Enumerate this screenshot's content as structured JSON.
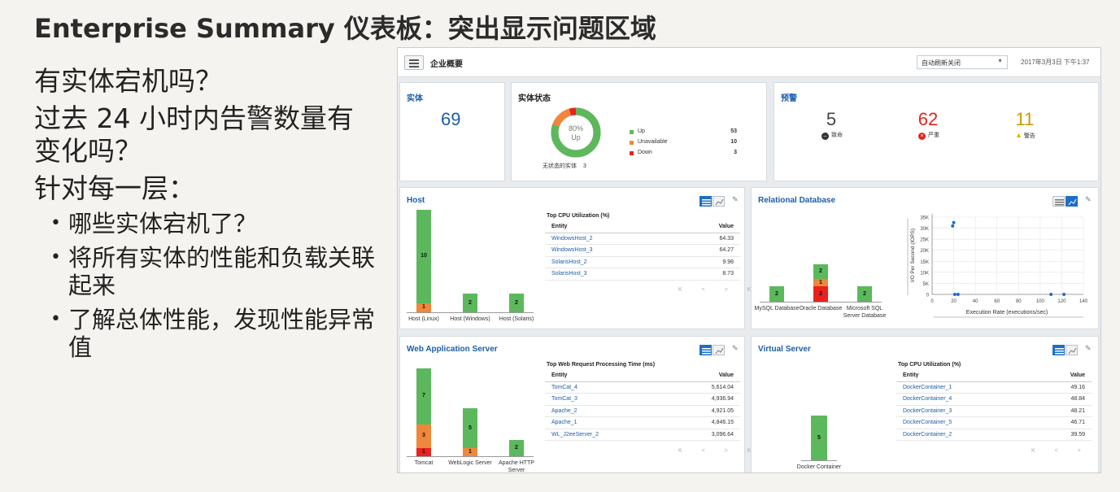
{
  "slide": {
    "title": "Enterprise Summary 仪表板：突出显示问题区域",
    "q1": "有实体宕机吗？",
    "q2": "过去 24 小时内告警数量有变化吗？",
    "q3": "针对每一层：",
    "points": [
      "哪些实体宕机了？",
      "将所有实体的性能和负载关联起来",
      "了解总体性能，发现性能异常值"
    ]
  },
  "dashboard": {
    "title": "企业概要",
    "refresh": "自动刷新关闭",
    "datetime": "2017年3月3日 下午1:37",
    "entities": {
      "title": "实体",
      "count": "69"
    },
    "status": {
      "title": "实体状态",
      "donut_pct": "80%",
      "donut_label": "Up",
      "up_fraction": 0.8,
      "items": [
        {
          "label": "Up",
          "count": "53",
          "color": "#5cb85c"
        },
        {
          "label": "Unavailable",
          "count": "10",
          "color": "#f0873a"
        },
        {
          "label": "Down",
          "count": "3",
          "color": "#e8231f"
        }
      ],
      "no_status_label": "无状态的实体",
      "no_status_count": "3"
    },
    "alerts": {
      "title": "预警",
      "fatal": {
        "count": "5",
        "label": "致命",
        "color": "#444444"
      },
      "critical": {
        "count": "62",
        "label": "严重",
        "color": "#e8231f"
      },
      "warning": {
        "count": "11",
        "label": "警告",
        "color": "#c99a00"
      }
    },
    "host": {
      "title": "Host",
      "bars": [
        {
          "cat": "Host (Linux)",
          "up": 10,
          "unavail": 1,
          "down": 0
        },
        {
          "cat": "Host (Windows)",
          "up": 2,
          "unavail": 0,
          "down": 0
        },
        {
          "cat": "Host (Solaris)",
          "up": 2,
          "unavail": 0,
          "down": 0
        }
      ],
      "table_title": "Top CPU Utilization (%)",
      "col_entity": "Entity",
      "col_value": "Value",
      "rows": [
        {
          "entity": "WindowsHost_2",
          "value": "64.33"
        },
        {
          "entity": "WindowsHost_3",
          "value": "64.27"
        },
        {
          "entity": "SolarisHost_2",
          "value": "9.98"
        },
        {
          "entity": "SolarisHost_3",
          "value": "8.73"
        }
      ]
    },
    "db": {
      "title": "Relational Database",
      "bars": [
        {
          "cat": "MySQL Database",
          "up": 2,
          "unavail": 0,
          "down": 0
        },
        {
          "cat": "Oracle Database",
          "up": 2,
          "unavail": 1,
          "down": 2
        },
        {
          "cat": "Microsoft SQL Server Database",
          "up": 2,
          "unavail": 0,
          "down": 0
        }
      ],
      "scatter": {
        "xlabel": "Execution Rate (executions/sec)",
        "ylabel": "I/O Per Second (IOPS)",
        "xlim": [
          0,
          140
        ],
        "ylim": [
          0,
          35000
        ],
        "xticks": [
          "0",
          "20",
          "40",
          "60",
          "80",
          "100",
          "120",
          "140"
        ],
        "yticks": [
          "0",
          "5K",
          "10K",
          "15K",
          "20K",
          "25K",
          "30K",
          "35K"
        ],
        "points": [
          [
            19,
            31000
          ],
          [
            20,
            32500
          ],
          [
            21,
            0
          ],
          [
            24,
            0
          ],
          [
            110,
            0
          ],
          [
            122,
            0
          ]
        ]
      }
    },
    "web": {
      "title": "Web Application Server",
      "bars": [
        {
          "cat": "Tomcat",
          "up": 7,
          "unavail": 3,
          "down": 1
        },
        {
          "cat": "WebLogic Server",
          "up": 5,
          "unavail": 1,
          "down": 0
        },
        {
          "cat": "Apache HTTP Server",
          "up": 2,
          "unavail": 0,
          "down": 0
        }
      ],
      "table_title": "Top Web Request Processing Time (ms)",
      "col_entity": "Entity",
      "col_value": "Value",
      "rows": [
        {
          "entity": "TomCat_4",
          "value": "5,614.04"
        },
        {
          "entity": "TomCat_3",
          "value": "4,936.94"
        },
        {
          "entity": "Apache_2",
          "value": "4,921.05"
        },
        {
          "entity": "Apache_1",
          "value": "4,846.15"
        },
        {
          "entity": "WL_J2eeServer_2",
          "value": "3,096.64"
        }
      ]
    },
    "virtual": {
      "title": "Virtual Server",
      "bars": [
        {
          "cat": "Docker Container",
          "up": 5,
          "unavail": 0,
          "down": 0
        }
      ],
      "table_title": "Top CPU Utilization (%)",
      "col_entity": "Entity",
      "col_value": "Value",
      "rows": [
        {
          "entity": "DockerContainer_1",
          "value": "49.16"
        },
        {
          "entity": "DockerContainer_4",
          "value": "48.84"
        },
        {
          "entity": "DockerContainer_3",
          "value": "48.21"
        },
        {
          "entity": "DockerContainer_5",
          "value": "46.71"
        },
        {
          "entity": "DockerContainer_2",
          "value": "39.59"
        }
      ]
    },
    "pager": "K < > K",
    "colors": {
      "up": "#5cb85c",
      "unavail": "#f0873a",
      "down": "#e8231f",
      "accent": "#1d5ea8"
    }
  }
}
